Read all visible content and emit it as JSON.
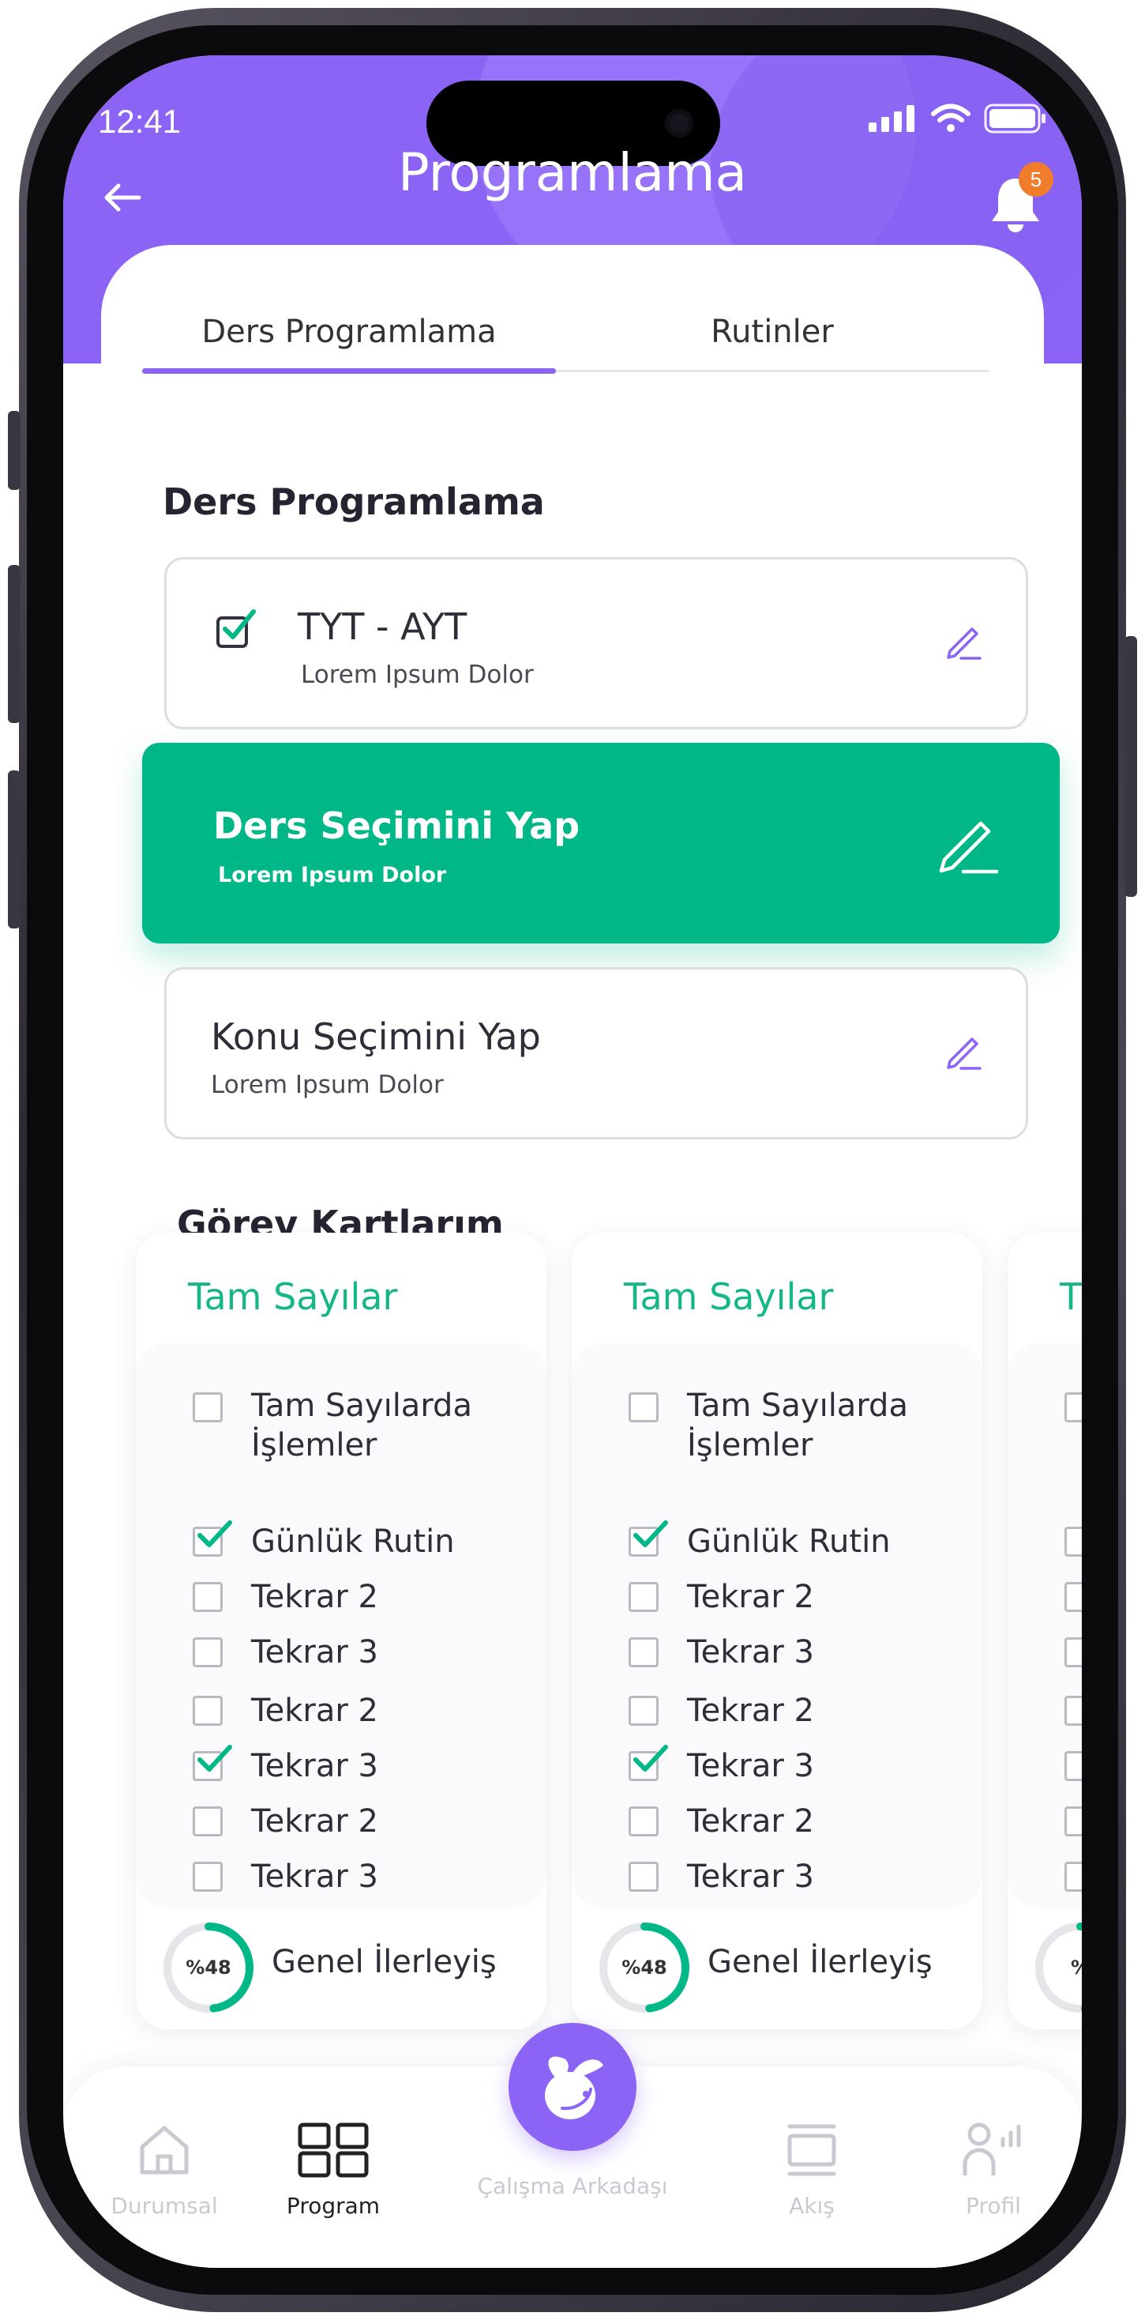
{
  "status_bar": {
    "time": "12:41"
  },
  "header": {
    "title": "Programlama",
    "notification_count": "5"
  },
  "tabs": [
    {
      "label": "Ders Programlama",
      "active": true
    },
    {
      "label": "Rutinler",
      "active": false
    }
  ],
  "program_section": {
    "title": "Ders Programlama",
    "cards": [
      {
        "title": "TYT - AYT",
        "subtitle": "Lorem Ipsum Dolor",
        "checked": true
      },
      {
        "title": "Ders Seçimini Yap",
        "subtitle": "Lorem Ipsum Dolor",
        "highlighted": true
      },
      {
        "title": "Konu Seçimini Yap",
        "subtitle": "Lorem Ipsum Dolor"
      }
    ]
  },
  "tasks_section": {
    "title": "Görev Kartlarım"
  },
  "task_cards": [
    {
      "title": "Tam Sayılar",
      "items": [
        {
          "label_line1": "Tam Sayılarda",
          "label_line2": "İşlemler",
          "checked": false
        },
        {
          "label": "Günlük Rutin",
          "checked": true
        },
        {
          "label": "Tekrar 2",
          "checked": false
        },
        {
          "label": "Tekrar 3",
          "checked": false
        },
        {
          "label": "Tekrar 2",
          "checked": false
        },
        {
          "label": "Tekrar 3",
          "checked": true
        },
        {
          "label": "Tekrar 2",
          "checked": false
        },
        {
          "label": "Tekrar 3",
          "checked": false
        }
      ],
      "progress_text": "%48",
      "progress_value": 0.48,
      "progress_label": "Genel İlerleyiş"
    },
    {
      "title": "Tam Sayılar",
      "items": [
        {
          "label_line1": "Tam Sayılarda",
          "label_line2": "İşlemler",
          "checked": false
        },
        {
          "label": "Günlük Rutin",
          "checked": true
        },
        {
          "label": "Tekrar 2",
          "checked": false
        },
        {
          "label": "Tekrar 3",
          "checked": false
        },
        {
          "label": "Tekrar 2",
          "checked": false
        },
        {
          "label": "Tekrar 3",
          "checked": true
        },
        {
          "label": "Tekrar 2",
          "checked": false
        },
        {
          "label": "Tekrar 3",
          "checked": false
        }
      ],
      "progress_text": "%48",
      "progress_value": 0.48,
      "progress_label": "Genel İlerleyiş"
    },
    {
      "title": "T",
      "progress_text": "%"
    }
  ],
  "bottom_nav": {
    "items": [
      {
        "label": "Durumsal",
        "icon": "home-icon",
        "active": false
      },
      {
        "label": "Program",
        "icon": "grid-icon",
        "active": true
      },
      {
        "label": "Akış",
        "icon": "feed-icon",
        "active": false
      },
      {
        "label": "Profil",
        "icon": "profile-icon",
        "active": false
      }
    ],
    "center": {
      "label": "Çalışma Arkadaşı",
      "icon": "rabbit-logo-icon"
    }
  },
  "colors": {
    "primary": "#8C64F5",
    "accent": "#00B887",
    "badge": "#F07D2C"
  }
}
